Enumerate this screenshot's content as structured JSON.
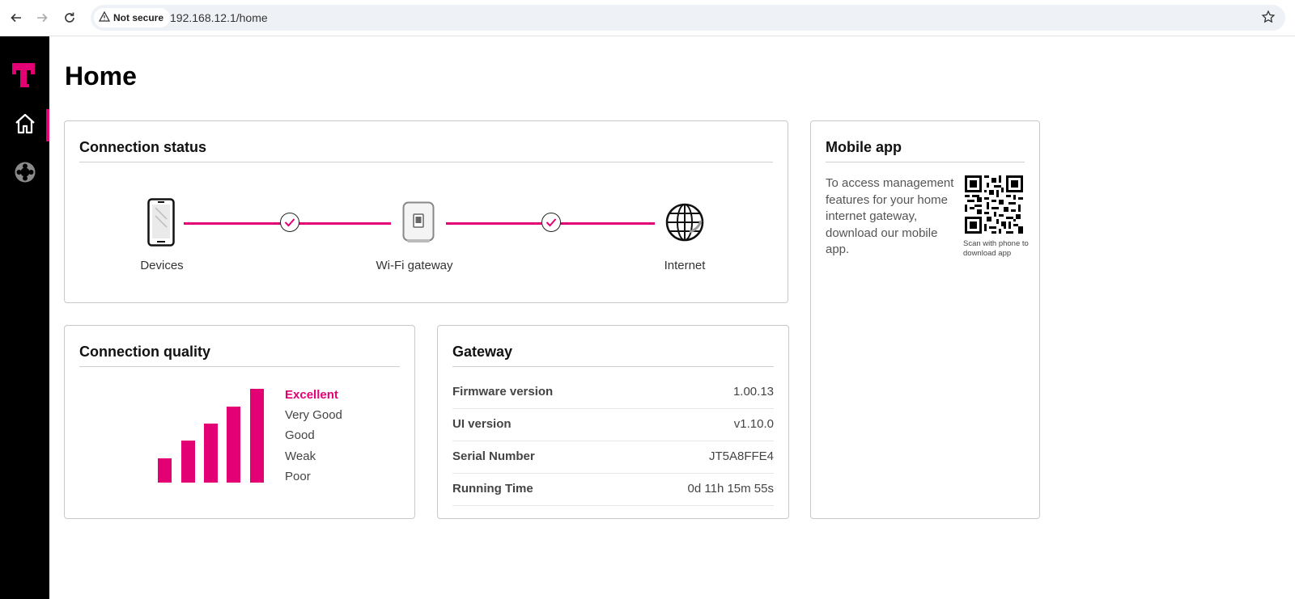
{
  "browser": {
    "security_label": "Not secure",
    "url": "192.168.12.1/home"
  },
  "page": {
    "title": "Home"
  },
  "connection_status": {
    "title": "Connection status",
    "nodes": [
      {
        "label": "Devices",
        "icon": "phone-icon"
      },
      {
        "label": "Wi-Fi gateway",
        "icon": "gateway-icon"
      },
      {
        "label": "Internet",
        "icon": "globe-icon"
      }
    ]
  },
  "connection_quality": {
    "title": "Connection quality",
    "bars_filled": 5,
    "levels": [
      "Excellent",
      "Very Good",
      "Good",
      "Weak",
      "Poor"
    ],
    "current_level": "Excellent"
  },
  "gateway": {
    "title": "Gateway",
    "rows": [
      {
        "key": "Firmware version",
        "value": "1.00.13"
      },
      {
        "key": "UI version",
        "value": "v1.10.0"
      },
      {
        "key": "Serial Number",
        "value": "JT5A8FFE4"
      },
      {
        "key": "Running Time",
        "value": "0d 11h 15m 55s"
      }
    ]
  },
  "mobile_app": {
    "title": "Mobile app",
    "description": "To access management features for your home internet gateway, download our mobile app.",
    "qr_caption": "Scan with phone to download app"
  },
  "colors": {
    "accent": "#e20074",
    "sidebar": "#000000"
  }
}
